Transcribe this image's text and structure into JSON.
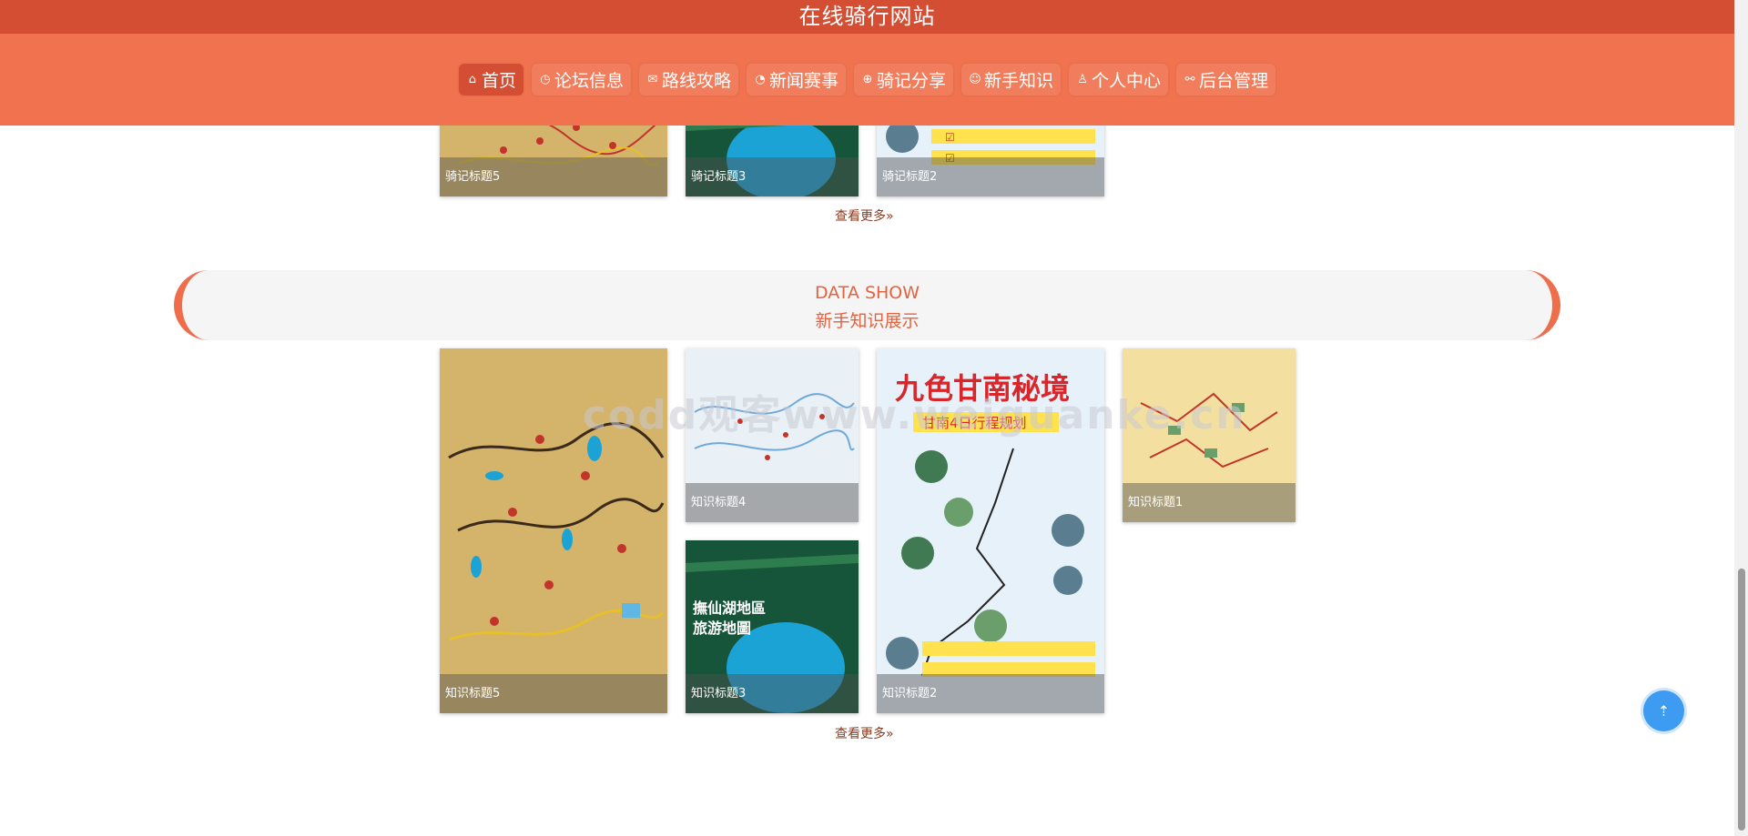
{
  "site_title": "在线骑行网站",
  "nav": [
    {
      "label": "首页",
      "icon": "home-icon",
      "glyph": "⌂",
      "active": true
    },
    {
      "label": "论坛信息",
      "icon": "clock-icon",
      "glyph": "◷",
      "active": false
    },
    {
      "label": "路线攻略",
      "icon": "mail-icon",
      "glyph": "✉",
      "active": false
    },
    {
      "label": "新闻赛事",
      "icon": "dashboard-icon",
      "glyph": "◔",
      "active": false
    },
    {
      "label": "骑记分享",
      "icon": "globe-icon",
      "glyph": "⊕",
      "active": false
    },
    {
      "label": "新手知识",
      "icon": "palette-icon",
      "glyph": "☺",
      "active": false
    },
    {
      "label": "个人中心",
      "icon": "user-icon",
      "glyph": "♙",
      "active": false
    },
    {
      "label": "后台管理",
      "icon": "link-icon",
      "glyph": "⚯",
      "active": false
    }
  ],
  "riding_section": {
    "cards": [
      {
        "caption": "骑记标题5"
      },
      {
        "caption": "骑记标题3"
      },
      {
        "caption": "骑记标题2"
      }
    ],
    "more": "查看更多»"
  },
  "knowledge_section": {
    "title_en": "DATA SHOW",
    "title_cn": "新手知识展示",
    "cards": [
      {
        "caption": "知识标题5"
      },
      {
        "caption": "知识标题4"
      },
      {
        "caption": "知识标题1"
      },
      {
        "caption": "知识标题3"
      },
      {
        "caption": "知识标题2"
      }
    ],
    "more": "查看更多»"
  },
  "watermark": "codd观客www.weiguanke.cn",
  "colors": {
    "title_bar": "#d44e33",
    "nav_bg": "#f0724f",
    "accent": "#e2633f"
  }
}
